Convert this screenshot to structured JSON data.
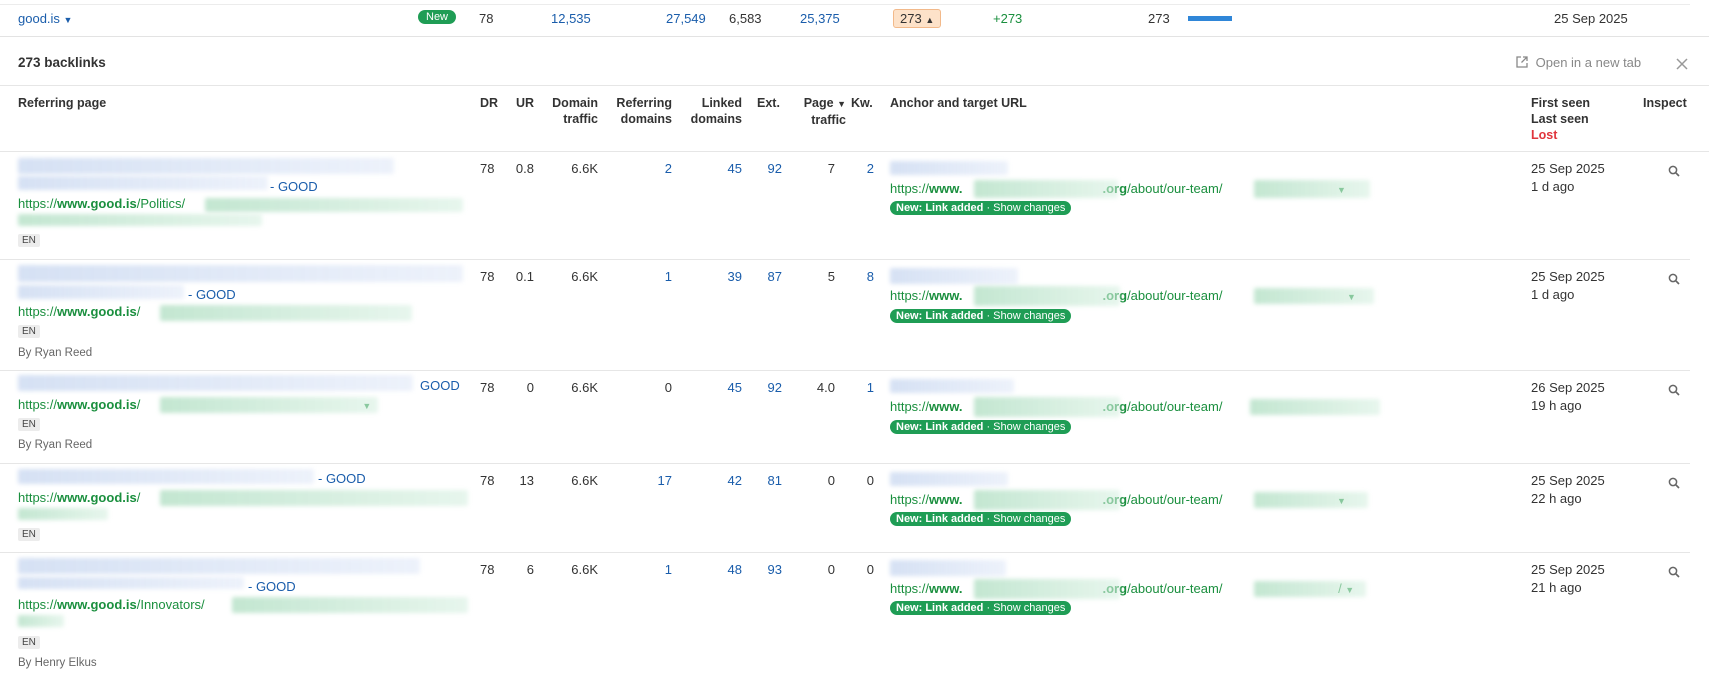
{
  "top_row": {
    "domain": "good.is",
    "badge": "New",
    "dr": "78",
    "c1": "12,535",
    "c2": "27,549",
    "c3": "6,583",
    "c4": "25,375",
    "pill": "273",
    "delta": "+273",
    "total": "273",
    "date": "25 Sep 2025"
  },
  "panel": {
    "title": "273 backlinks",
    "open_new_tab": "Open in a new tab"
  },
  "headers": {
    "referring_page": "Referring page",
    "dr": "DR",
    "ur": "UR",
    "domain_traffic_1": "Domain",
    "domain_traffic_2": "traffic",
    "referring_domains_1": "Referring",
    "referring_domains_2": "domains",
    "linked_domains_1": "Linked",
    "linked_domains_2": "domains",
    "ext": "Ext.",
    "page_traffic_1": "Page",
    "page_traffic_2": "traffic",
    "kw": "Kw.",
    "anchor": "Anchor and target URL",
    "first_seen": "First seen",
    "last_seen": "Last seen",
    "lost": "Lost",
    "inspect": "Inspect"
  },
  "rows": [
    {
      "title_suffix": "- GOOD",
      "url_prefix": "https://",
      "url_domain": "www.good.is",
      "url_path": "/Politics/",
      "lang": "EN",
      "author": "",
      "dr": "78",
      "ur": "0.8",
      "dt": "6.6K",
      "rd": "2",
      "ld": "45",
      "ext": "92",
      "pt": "7",
      "kw": "2",
      "target_prefix": "https://",
      "target_www": "www.",
      "target_tld": ".org",
      "target_path": "/about/our-team/",
      "tag_bold": "New: Link added",
      "tag_rest": " · Show changes",
      "first_seen": "25 Sep 2025",
      "last_seen": "1 d ago"
    },
    {
      "title_suffix": "- GOOD",
      "url_prefix": "https://",
      "url_domain": "www.good.is",
      "url_path": "/",
      "lang": "EN",
      "author": "By Ryan Reed",
      "dr": "78",
      "ur": "0.1",
      "dt": "6.6K",
      "rd": "1",
      "ld": "39",
      "ext": "87",
      "pt": "5",
      "kw": "8",
      "target_prefix": "https://",
      "target_www": "www.",
      "target_tld": ".org",
      "target_path": "/about/our-team/",
      "tag_bold": "New: Link added",
      "tag_rest": " · Show changes",
      "first_seen": "25 Sep 2025",
      "last_seen": "1 d ago"
    },
    {
      "title_suffix": "GOOD",
      "url_prefix": "https://",
      "url_domain": "www.good.is",
      "url_path": "/",
      "lang": "EN",
      "author": "By Ryan Reed",
      "dr": "78",
      "ur": "0",
      "dt": "6.6K",
      "rd": "0",
      "ld": "45",
      "ext": "92",
      "pt": "4.0",
      "kw": "1",
      "target_prefix": "https://",
      "target_www": "www.",
      "target_tld": ".org",
      "target_path": "/about/our-team/",
      "tag_bold": "New: Link added",
      "tag_rest": " · Show changes",
      "first_seen": "26 Sep 2025",
      "last_seen": "19 h ago"
    },
    {
      "title_suffix": "- GOOD",
      "url_prefix": "https://",
      "url_domain": "www.good.is",
      "url_path": "/",
      "lang": "EN",
      "author": "",
      "dr": "78",
      "ur": "13",
      "dt": "6.6K",
      "rd": "17",
      "ld": "42",
      "ext": "81",
      "pt": "0",
      "kw": "0",
      "target_prefix": "https://",
      "target_www": "www.",
      "target_tld": ".org",
      "target_path": "/about/our-team/",
      "tag_bold": "New: Link added",
      "tag_rest": " · Show changes",
      "first_seen": "25 Sep 2025",
      "last_seen": "22 h ago"
    },
    {
      "title_suffix": "- GOOD",
      "url_prefix": "https://",
      "url_domain": "www.good.is",
      "url_path": "/Innovators/",
      "lang": "EN",
      "author": "By Henry Elkus",
      "dr": "78",
      "ur": "6",
      "dt": "6.6K",
      "rd": "1",
      "ld": "48",
      "ext": "93",
      "pt": "0",
      "kw": "0",
      "target_prefix": "https://",
      "target_www": "www.",
      "target_tld": ".org",
      "target_path": "/about/our-team/",
      "tag_bold": "New: Link added",
      "tag_rest": " · Show changes",
      "first_seen": "25 Sep 2025",
      "last_seen": "21 h ago"
    }
  ],
  "colors": {
    "link_blue": "#1a5dab",
    "url_green": "#1a8f3e",
    "badge_green": "#1f9d55",
    "lost_red": "#e0353c",
    "pill_orange": "#fde2c9"
  },
  "icons": [
    "chevron-down-icon",
    "chevron-up-icon",
    "external-link-icon",
    "close-icon",
    "magnifier-icon"
  ]
}
